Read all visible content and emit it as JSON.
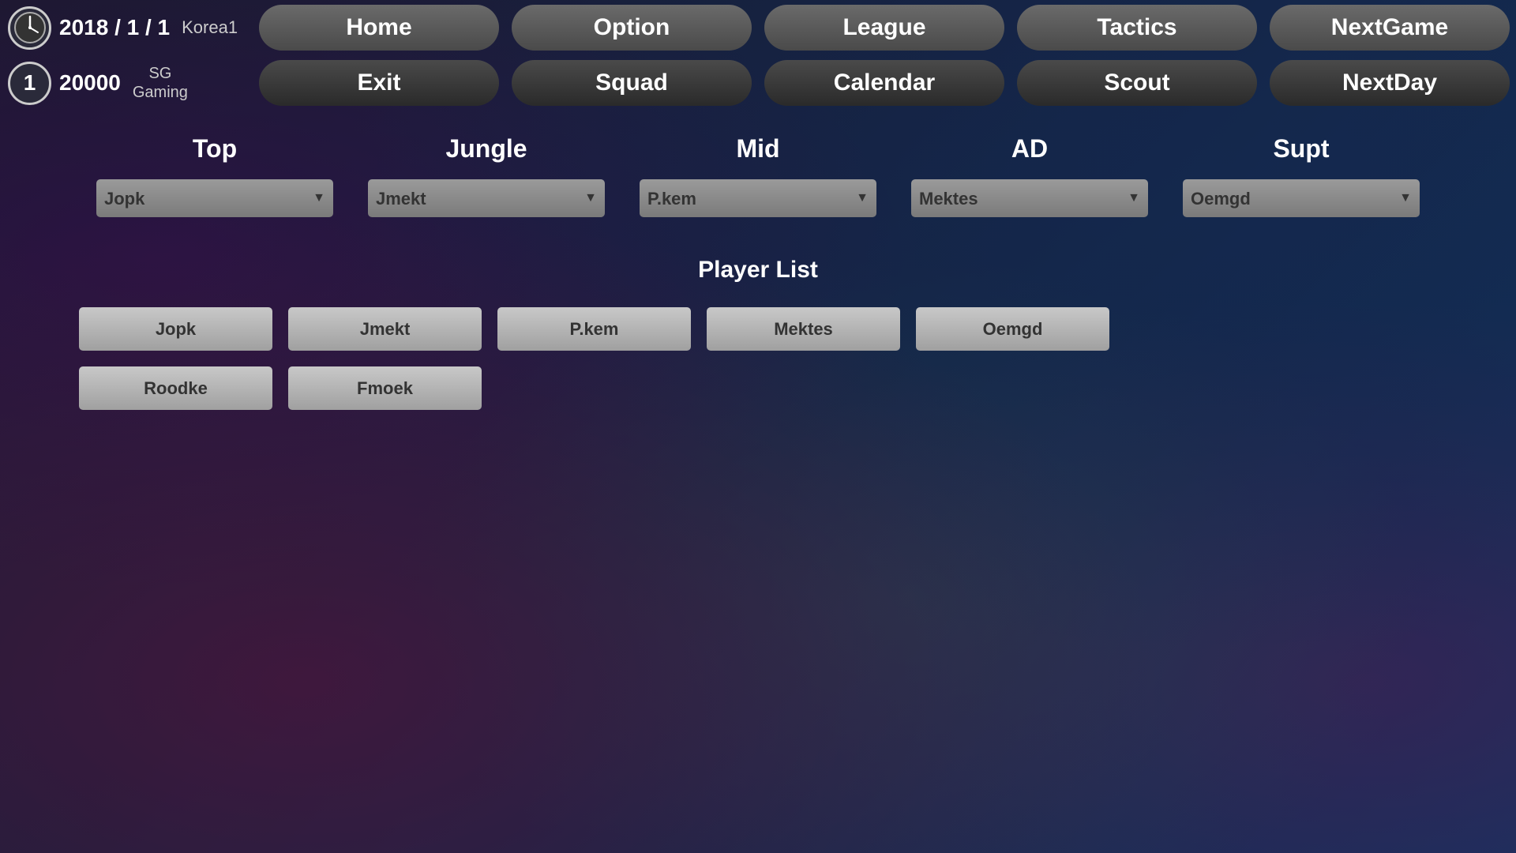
{
  "header": {
    "date": "2018 / 1 / 1",
    "region": "Korea1",
    "rank": "1",
    "money": "20000",
    "team_line1": "SG",
    "team_line2": "Gaming",
    "nav_row1": [
      {
        "id": "home",
        "label": "Home",
        "style": "light"
      },
      {
        "id": "option",
        "label": "Option",
        "style": "light"
      },
      {
        "id": "league",
        "label": "League",
        "style": "light"
      },
      {
        "id": "tactics",
        "label": "Tactics",
        "style": "light"
      },
      {
        "id": "nextgame",
        "label": "NextGame",
        "style": "light"
      }
    ],
    "nav_row2": [
      {
        "id": "exit",
        "label": "Exit",
        "style": "dark"
      },
      {
        "id": "squad",
        "label": "Squad",
        "style": "dark"
      },
      {
        "id": "calendar",
        "label": "Calendar",
        "style": "dark"
      },
      {
        "id": "scout",
        "label": "Scout",
        "style": "dark"
      },
      {
        "id": "nextday",
        "label": "NextDay",
        "style": "dark"
      }
    ]
  },
  "positions": {
    "labels": [
      "Top",
      "Jungle",
      "Mid",
      "AD",
      "Supt"
    ],
    "selected": [
      "Jopk",
      "Jmekt",
      "P.kem",
      "Mektes",
      "Oemgd"
    ],
    "options": [
      [
        "Jopk",
        "Roodke",
        "Fmoek"
      ],
      [
        "Jmekt",
        "Roodke",
        "Fmoek"
      ],
      [
        "P.kem",
        "Roodke",
        "Fmoek"
      ],
      [
        "Mektes",
        "Roodke",
        "Fmoek"
      ],
      [
        "Oemgd",
        "Roodke",
        "Fmoek"
      ]
    ]
  },
  "player_list": {
    "title": "Player List",
    "rows": [
      [
        "Jopk",
        "Jmekt",
        "P.kem",
        "Mektes",
        "Oemgd"
      ],
      [
        "Roodke",
        "Fmoek"
      ]
    ]
  }
}
